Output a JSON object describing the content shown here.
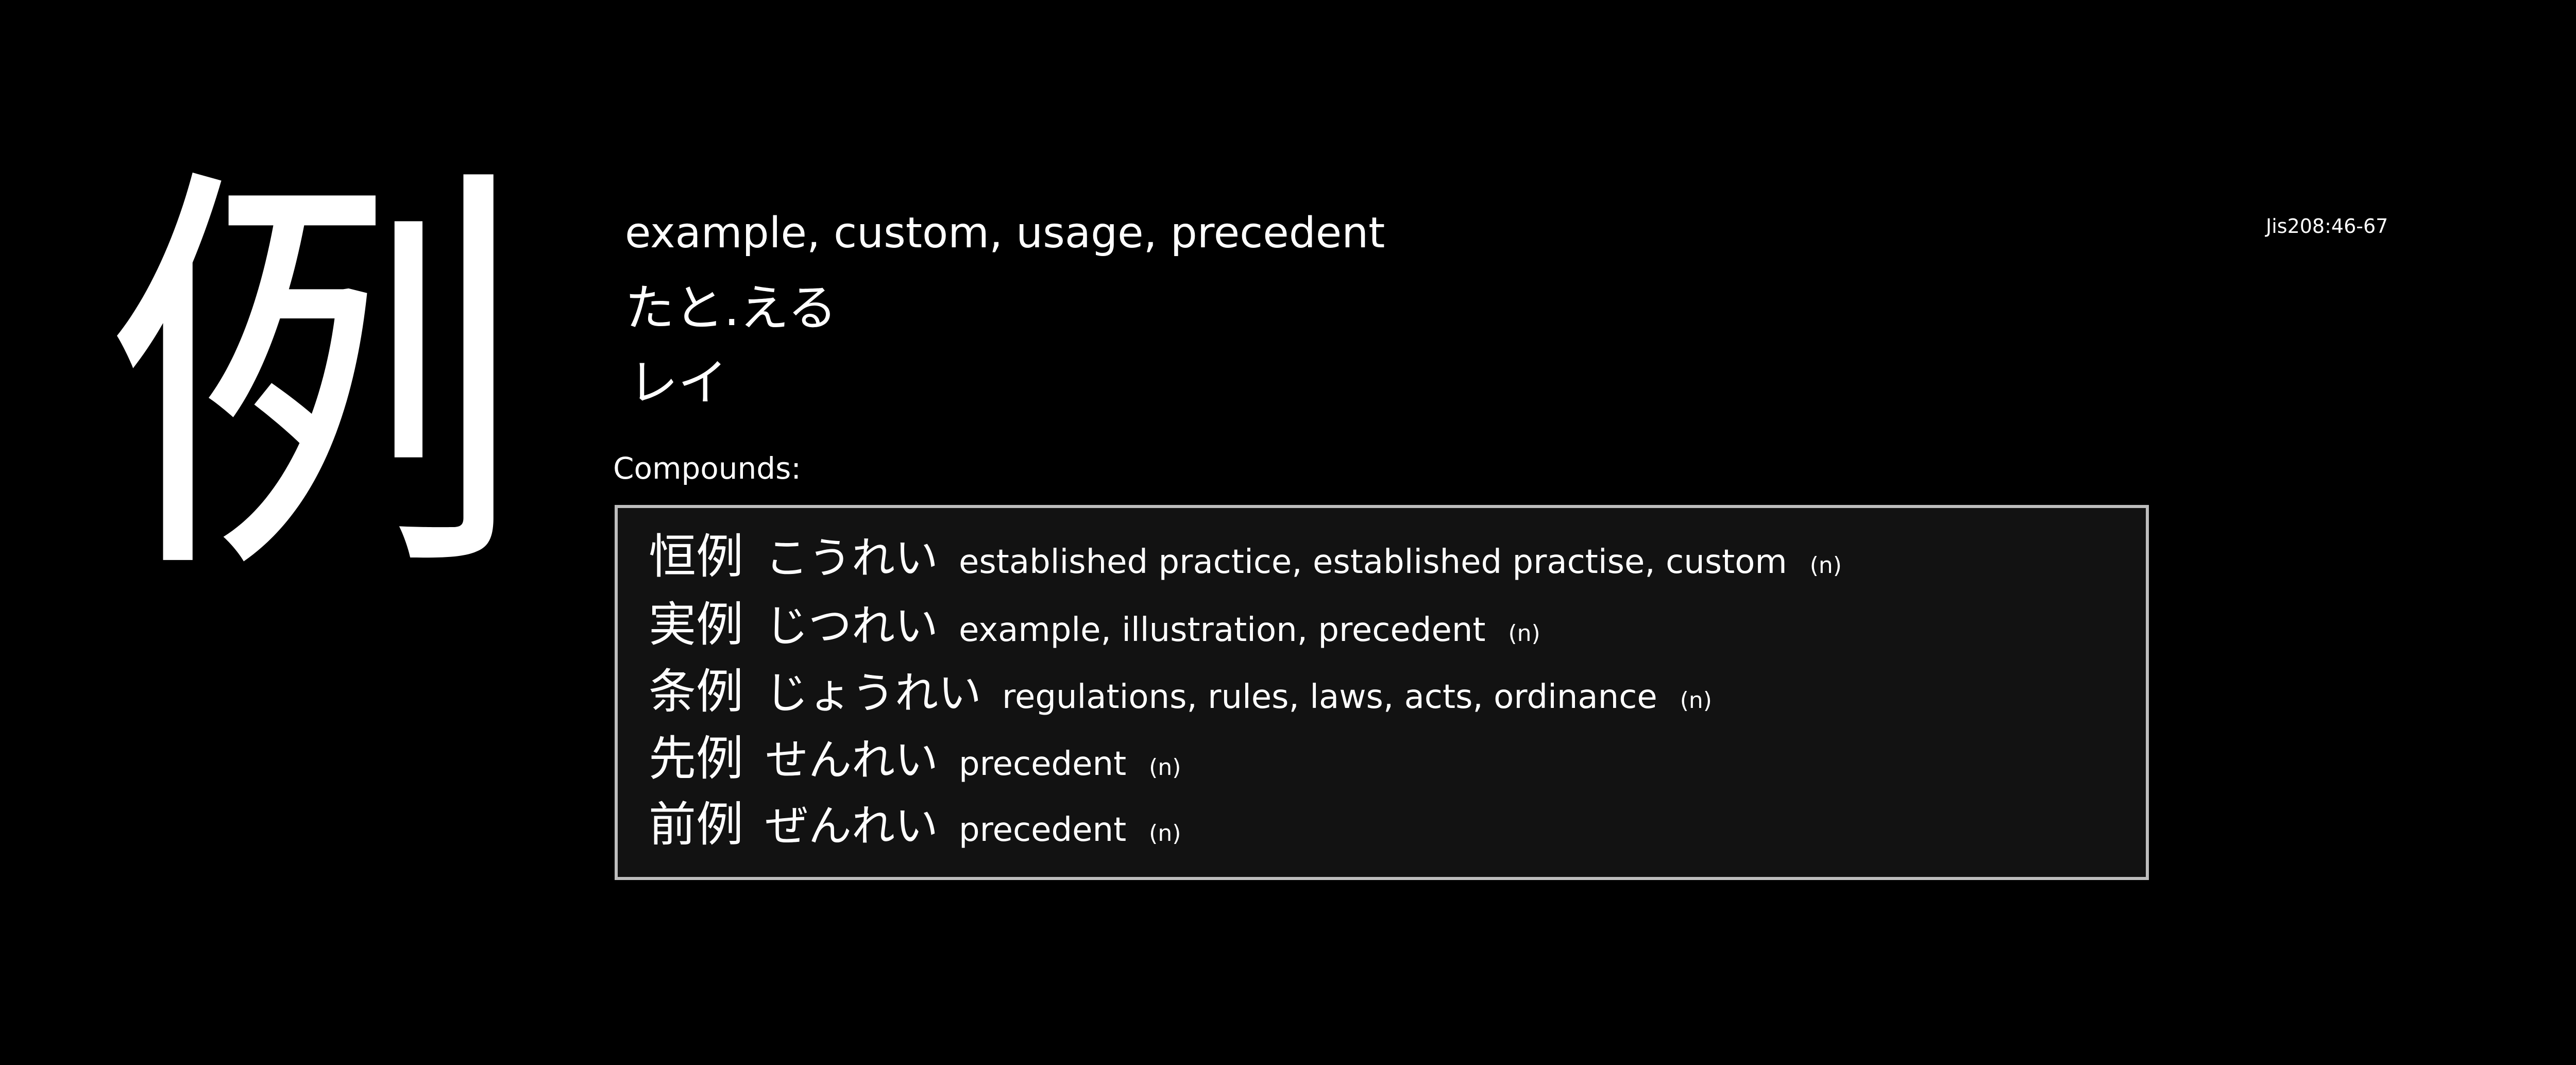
{
  "kanji": "例",
  "jis_code": "Jis208:46-67",
  "meaning": "example, custom, usage, precedent",
  "kun_reading": "たと.える",
  "on_reading": "レイ",
  "compounds_label": "Compounds:",
  "compounds": [
    {
      "kanji": "恒例",
      "kana": "こうれい",
      "gloss": "established practice, established practise, custom",
      "pos": "(n)"
    },
    {
      "kanji": "実例",
      "kana": "じつれい",
      "gloss": "example, illustration, precedent",
      "pos": "(n)"
    },
    {
      "kanji": "条例",
      "kana": "じょうれい",
      "gloss": "regulations, rules, laws, acts, ordinance",
      "pos": "(n)"
    },
    {
      "kanji": "先例",
      "kana": "せんれい",
      "gloss": "precedent",
      "pos": "(n)"
    },
    {
      "kanji": "前例",
      "kana": "ぜんれい",
      "gloss": "precedent",
      "pos": "(n)"
    }
  ],
  "colors": {
    "background": "#000000",
    "text": "#ffffff",
    "box_background": "#121212",
    "box_border": "#bdbdbd"
  }
}
